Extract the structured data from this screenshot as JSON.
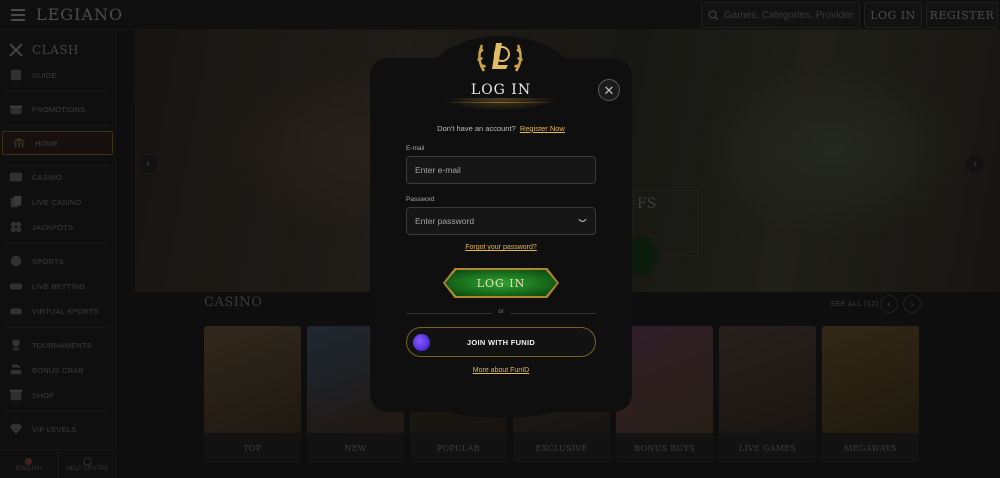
{
  "header": {
    "logo": "LEGIANO",
    "search_placeholder": "Games, Categories, Providers",
    "login_label": "LOG IN",
    "register_label": "REGISTER"
  },
  "sidebar": {
    "clash_label": "CLASH",
    "items": [
      {
        "label": "GUIDE",
        "icon": "book-icon"
      },
      {
        "label": "PROMOTIONS",
        "icon": "gift-icon"
      },
      {
        "label": "HOME",
        "icon": "temple-icon"
      },
      {
        "label": "CASINO",
        "icon": "slot-icon"
      },
      {
        "label": "LIVE CASINO",
        "icon": "cards-icon"
      },
      {
        "label": "JACKPOTS",
        "icon": "clover-icon"
      },
      {
        "label": "SPORTS",
        "icon": "ball-icon"
      },
      {
        "label": "LIVE BETTING",
        "icon": "stadium-icon"
      },
      {
        "label": "VIRTUAL SPORTS",
        "icon": "gamepad-icon"
      },
      {
        "label": "TOURNAMENTS",
        "icon": "trophy-icon"
      },
      {
        "label": "BONUS CRAB",
        "icon": "crab-icon"
      },
      {
        "label": "SHOP",
        "icon": "shop-icon"
      },
      {
        "label": "VIP LEVELS",
        "icon": "diamond-icon"
      }
    ],
    "language_label": "ENGLISH",
    "help_label": "HELP CENTRE"
  },
  "hero": {
    "partial_text": "FS"
  },
  "casino": {
    "title": "CASINO",
    "see_all": "SEE ALL (12)",
    "cards": [
      "TOP",
      "NEW",
      "POPULAR",
      "EXCLUSIVE",
      "BONUS BUYS",
      "LIVE GAMES",
      "MEGAWAYS"
    ]
  },
  "modal": {
    "title": "LOG IN",
    "no_account_text": "Don't have an account?",
    "register_link": "Register Now",
    "email_label": "E-mail",
    "email_placeholder": "Enter e-mail",
    "password_label": "Password",
    "password_placeholder": "Enter password",
    "forgot_link": "Forgot your password?",
    "submit_label": "LOG IN",
    "or_text": "or",
    "funid_label": "JOIN WITH FUNID",
    "more_funid": "More about FunID"
  },
  "colors": {
    "gold": "#e2b84b",
    "green": "#2fa431",
    "modal_bg": "#0f0f0f"
  }
}
